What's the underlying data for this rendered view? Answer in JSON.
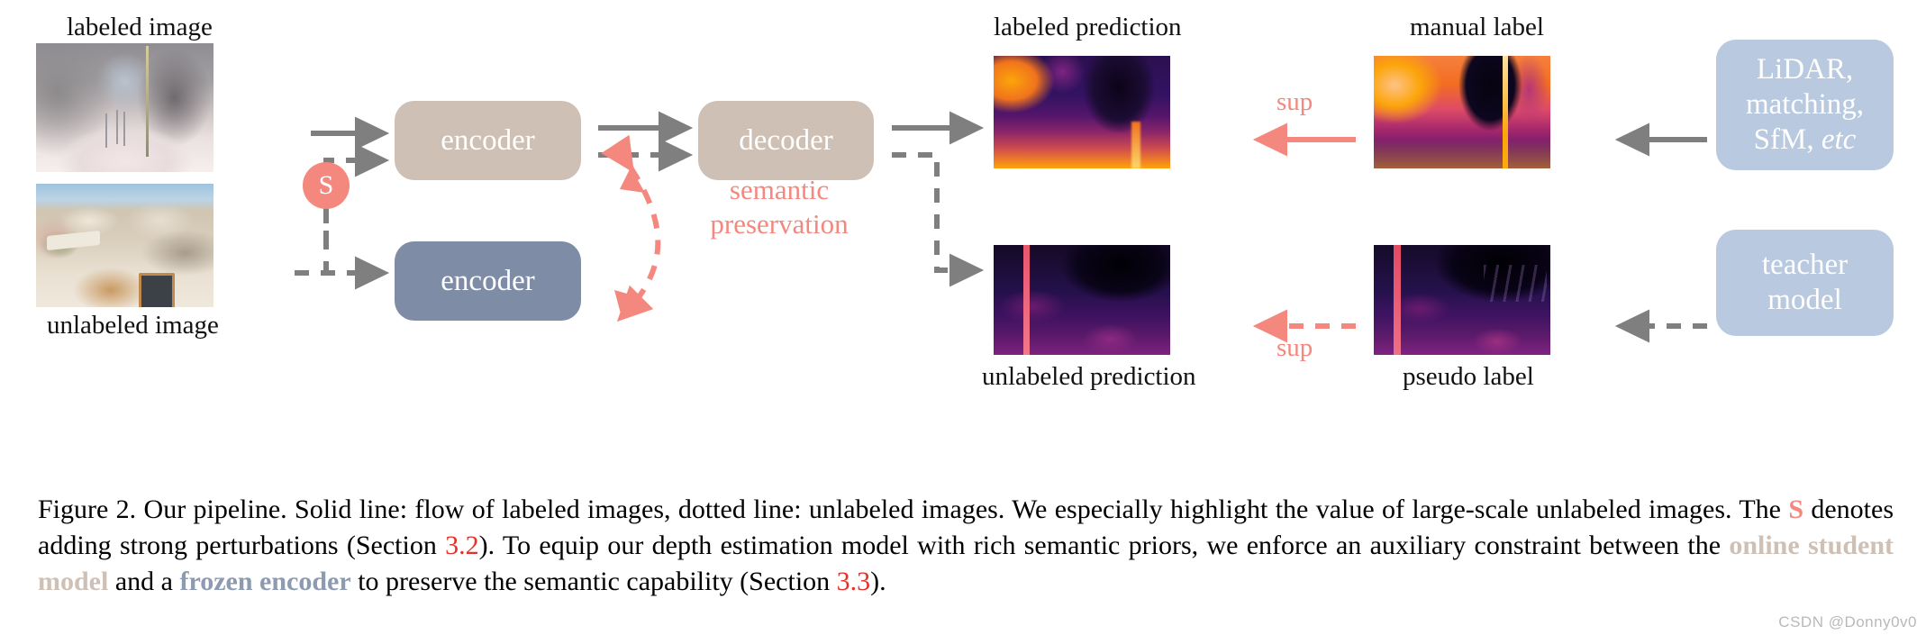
{
  "figure": {
    "labels": {
      "labeled_image": "labeled image",
      "unlabeled_image": "unlabeled image",
      "labeled_prediction": "labeled prediction",
      "unlabeled_prediction": "unlabeled prediction",
      "manual_label": "manual label",
      "pseudo_label": "pseudo label",
      "semantic_preservation_line1": "semantic",
      "semantic_preservation_line2": "preservation",
      "sup_top": "sup",
      "sup_bottom": "sup"
    },
    "boxes": {
      "encoder_student": "encoder",
      "encoder_frozen": "encoder",
      "decoder": "decoder",
      "lidar_line1": "LiDAR,",
      "lidar_line2": "matching,",
      "lidar_line3_plain": "SfM, ",
      "lidar_line3_italic": "etc",
      "teacher_line1": "teacher",
      "teacher_line2": "model"
    },
    "badge": {
      "strong_perturbation": "S"
    },
    "colors": {
      "tan": "#cfc0b5",
      "slate": "#7f8ca5",
      "light_blue": "#b9c9e0",
      "salmon": "#f4877e",
      "gray_arrow": "#7f7f7f",
      "section_red": "#e8302a"
    }
  },
  "caption": {
    "p1": "Figure 2. Our pipeline. Solid line: flow of labeled images, dotted line: unlabeled images. We especially highlight the value of large-scale unlabeled images. The ",
    "s": "S",
    "p2": " denotes adding strong perturbations (Section ",
    "sec32": "3.2",
    "p3": "). To equip our depth estimation model with rich semantic priors, we enforce an auxiliary constraint between the ",
    "online_student": "online student model",
    "p4": " and a ",
    "frozen_encoder": "frozen encoder",
    "p5": " to preserve the semantic capability (Section ",
    "sec33": "3.3",
    "p6": ")."
  },
  "watermark": {
    "text": "CSDN @Donny0v0"
  }
}
